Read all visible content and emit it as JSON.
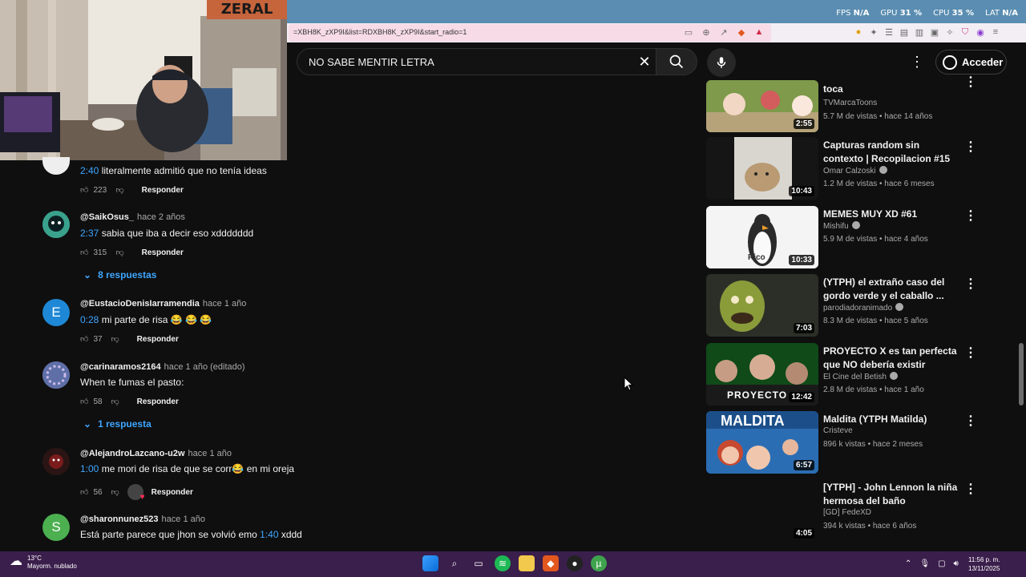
{
  "browser": {
    "url": "=XBH8K_zXP9I&list=RDXBH8K_zXP9I&start_radio=1",
    "hud": {
      "fps_label": "FPS",
      "fps_value": "N/A",
      "gpu_label": "GPU",
      "gpu_value": "31 %",
      "cpu_label": "CPU",
      "cpu_value": "35 %",
      "lat_label": "LAT",
      "lat_value": "N/A"
    }
  },
  "webcam": {
    "logo": "ZERAL"
  },
  "header": {
    "search_query": "NO SABE MENTIR LETRA",
    "signin_label": "Acceder"
  },
  "comments": [
    {
      "handle": "",
      "when": "",
      "timestamp": "2:40",
      "text": " literalmente admitió que no tenía ideas",
      "likes": "223",
      "reply": "Responder"
    },
    {
      "handle": "@SaikOsus_",
      "when": "hace 2 años",
      "timestamp": "2:37",
      "text": " sabia que iba a decir eso xddddddd",
      "likes": "315",
      "reply": "Responder",
      "replies": "8 respuestas"
    },
    {
      "handle": "@EustacioDenisIarramendia",
      "when": "hace 1 año",
      "timestamp": "0:28",
      "text": " mi parte de risa 😂 😂 😂",
      "likes": "37",
      "reply": "Responder",
      "avatar_letter": "E"
    },
    {
      "handle": "@carinaramos2164",
      "when": "hace 1 año (editado)",
      "timestamp": "",
      "text": "When te fumas el pasto:",
      "likes": "58",
      "reply": "Responder",
      "replies": "1 respuesta"
    },
    {
      "handle": "@AlejandroLazcano-u2w",
      "when": "hace 1 año",
      "timestamp": "1:00",
      "text": " me mori de risa de que se corr😂  en mi oreja",
      "likes": "56",
      "reply": "Responder"
    },
    {
      "handle": "@sharonnunez523",
      "when": "hace 1 año",
      "text_before": "Está parte parece que jhon se volvió emo ",
      "timestamp": "1:40",
      "text": " xddd",
      "avatar_letter": "S"
    }
  ],
  "sidebar": {
    "videos": [
      {
        "title": "toca",
        "channel": "TVMarcaToons",
        "verified": false,
        "meta": "5.7 M de vistas • hace 14 años",
        "duration": "2:55"
      },
      {
        "title": "Capturas random sin contexto | Recopilacion #15",
        "channel": "Omar Calzoski",
        "verified": true,
        "meta": "1.2 M de vistas • hace 6 meses",
        "duration": "10:43"
      },
      {
        "title": "MEMES MUY XD #61",
        "channel": "Mishifu",
        "verified": true,
        "meta": "5.9 M de vistas • hace 4 años",
        "duration": "10:33",
        "thumb_text": "Rico"
      },
      {
        "title": "(YTPH) el extraño caso del gordo verde y el caballo ...",
        "channel": "parodiadoranimado",
        "verified": true,
        "meta": "8.3 M de vistas • hace 5 años",
        "duration": "7:03"
      },
      {
        "title": "PROYECTO X es tan perfecta que NO debería existir",
        "channel": "El Cine del Betish",
        "verified": true,
        "meta": "2.8 M de vistas • hace 1 año",
        "duration": "12:42",
        "thumb_text": "PROYECTO"
      },
      {
        "title": "Maldita (YTPH Matilda)",
        "channel": "Cristeve",
        "verified": false,
        "meta": "896 k vistas • hace 2 meses",
        "duration": "6:57",
        "thumb_text": "MALDITA"
      },
      {
        "title": "[YTPH] - John Lennon la niña hermosa del baño",
        "channel": "[GD] FedeXD",
        "verified": false,
        "meta": "394 k vistas • hace 6 años",
        "duration": "4:05"
      }
    ]
  },
  "taskbar": {
    "weather_temp": "13°C",
    "weather_desc": "Mayorm. nublado",
    "time": "11:56 p. m.",
    "date": "13/11/2025"
  }
}
